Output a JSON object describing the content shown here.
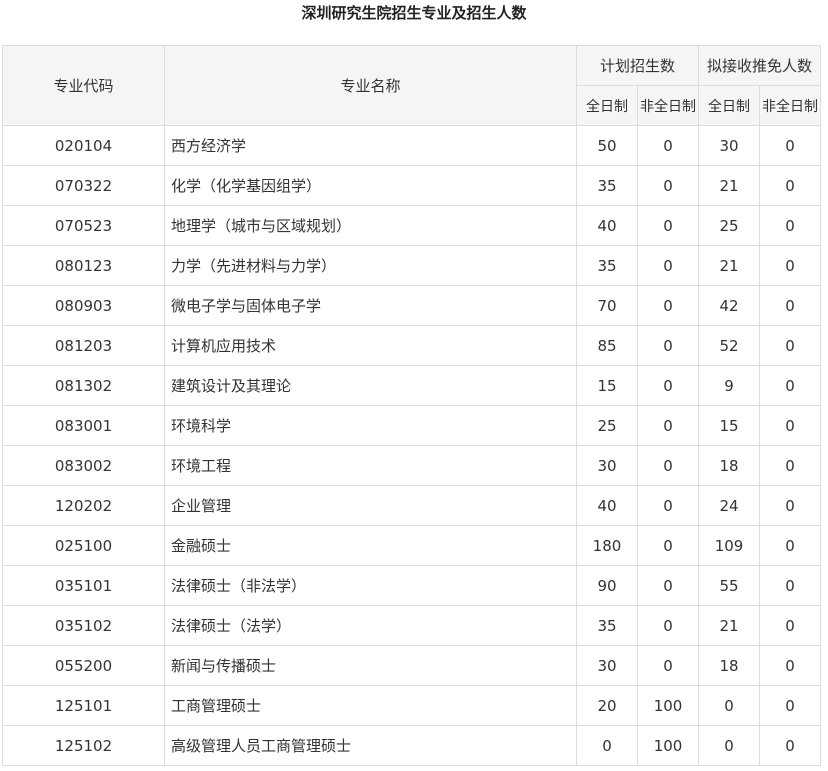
{
  "title": "深圳研究生院招生专业及招生人数",
  "headers": {
    "code": "专业代码",
    "name": "专业名称",
    "planned": "计划招生数",
    "exempt": "拟接收推免人数",
    "full_time": "全日制",
    "part_time": "非全日制"
  },
  "rows": [
    {
      "code": "020104",
      "name": "西方经济学",
      "plan_ft": "50",
      "plan_pt": "0",
      "ex_ft": "30",
      "ex_pt": "0"
    },
    {
      "code": "070322",
      "name": "化学（化学基因组学）",
      "plan_ft": "35",
      "plan_pt": "0",
      "ex_ft": "21",
      "ex_pt": "0"
    },
    {
      "code": "070523",
      "name": "地理学（城市与区域规划）",
      "plan_ft": "40",
      "plan_pt": "0",
      "ex_ft": "25",
      "ex_pt": "0"
    },
    {
      "code": "080123",
      "name": "力学（先进材料与力学）",
      "plan_ft": "35",
      "plan_pt": "0",
      "ex_ft": "21",
      "ex_pt": "0"
    },
    {
      "code": "080903",
      "name": "微电子学与固体电子学",
      "plan_ft": "70",
      "plan_pt": "0",
      "ex_ft": "42",
      "ex_pt": "0"
    },
    {
      "code": "081203",
      "name": "计算机应用技术",
      "plan_ft": "85",
      "plan_pt": "0",
      "ex_ft": "52",
      "ex_pt": "0"
    },
    {
      "code": "081302",
      "name": "建筑设计及其理论",
      "plan_ft": "15",
      "plan_pt": "0",
      "ex_ft": "9",
      "ex_pt": "0"
    },
    {
      "code": "083001",
      "name": "环境科学",
      "plan_ft": "25",
      "plan_pt": "0",
      "ex_ft": "15",
      "ex_pt": "0"
    },
    {
      "code": "083002",
      "name": "环境工程",
      "plan_ft": "30",
      "plan_pt": "0",
      "ex_ft": "18",
      "ex_pt": "0"
    },
    {
      "code": "120202",
      "name": "企业管理",
      "plan_ft": "40",
      "plan_pt": "0",
      "ex_ft": "24",
      "ex_pt": "0"
    },
    {
      "code": "025100",
      "name": "金融硕士",
      "plan_ft": "180",
      "plan_pt": "0",
      "ex_ft": "109",
      "ex_pt": "0"
    },
    {
      "code": "035101",
      "name": "法律硕士（非法学）",
      "plan_ft": "90",
      "plan_pt": "0",
      "ex_ft": "55",
      "ex_pt": "0"
    },
    {
      "code": "035102",
      "name": "法律硕士（法学）",
      "plan_ft": "35",
      "plan_pt": "0",
      "ex_ft": "21",
      "ex_pt": "0"
    },
    {
      "code": "055200",
      "name": "新闻与传播硕士",
      "plan_ft": "30",
      "plan_pt": "0",
      "ex_ft": "18",
      "ex_pt": "0"
    },
    {
      "code": "125101",
      "name": "工商管理硕士",
      "plan_ft": "20",
      "plan_pt": "100",
      "ex_ft": "0",
      "ex_pt": "0"
    },
    {
      "code": "125102",
      "name": "高级管理人员工商管理硕士",
      "plan_ft": "0",
      "plan_pt": "100",
      "ex_ft": "0",
      "ex_pt": "0"
    }
  ]
}
